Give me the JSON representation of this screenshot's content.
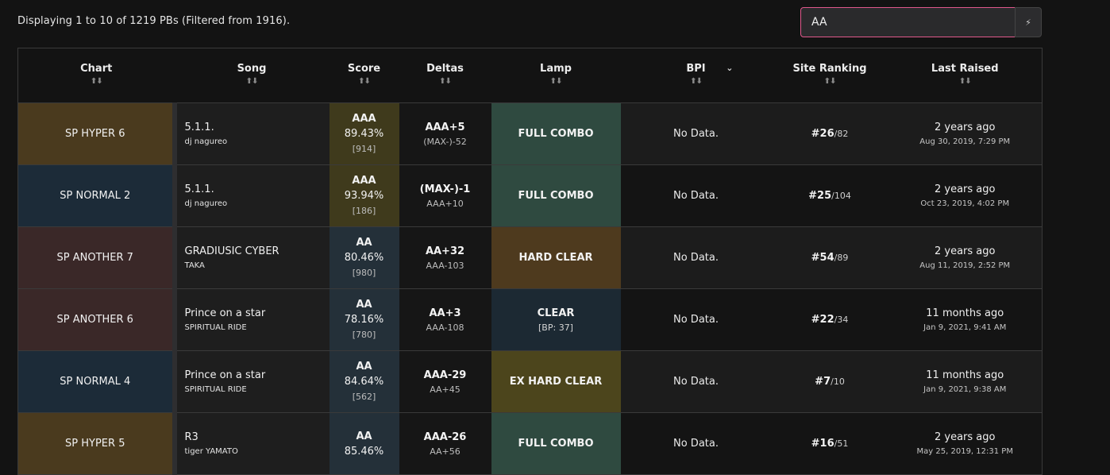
{
  "summary": "Displaying 1 to 10 of 1219 PBs (Filtered from 1916).",
  "search": {
    "value": "AA",
    "button_icon": "lightning-icon",
    "button_glyph": "⚡"
  },
  "columns": {
    "chart": "Chart",
    "song": "Song",
    "score": "Score",
    "deltas": "Deltas",
    "lamp": "Lamp",
    "bpi": "BPI",
    "ranking": "Site Ranking",
    "raised": "Last Raised",
    "sort_glyph": "⬆⬇",
    "bpi_chevron": "⌄"
  },
  "rows": [
    {
      "chart": "SP HYPER 6",
      "chart_class": "c-hyper",
      "song_title": "5.1.1.",
      "song_artist": "dj nagureo",
      "grade": "AAA",
      "percent": "89.43%",
      "ex": "[914]",
      "score_class": "s-aaa",
      "delta_main": "AAA+5",
      "delta_sub": "(MAX-)-52",
      "lamp": "FULL COMBO",
      "lamp_sub": "",
      "lamp_class": "l-fc",
      "bpi": "No Data.",
      "rank": "#26",
      "rank_total": "/82",
      "raised_rel": "2 years ago",
      "raised_abs": "Aug 30, 2019, 7:29 PM"
    },
    {
      "chart": "SP NORMAL 2",
      "chart_class": "c-normal",
      "song_title": "5.1.1.",
      "song_artist": "dj nagureo",
      "grade": "AAA",
      "percent": "93.94%",
      "ex": "[186]",
      "score_class": "s-aaa",
      "delta_main": "(MAX-)-1",
      "delta_sub": "AAA+10",
      "lamp": "FULL COMBO",
      "lamp_sub": "",
      "lamp_class": "l-fc",
      "bpi": "No Data.",
      "rank": "#25",
      "rank_total": "/104",
      "raised_rel": "2 years ago",
      "raised_abs": "Oct 23, 2019, 4:02 PM"
    },
    {
      "chart": "SP ANOTHER 7",
      "chart_class": "c-another",
      "song_title": "GRADIUSIC CYBER",
      "song_artist": "TAKA",
      "grade": "AA",
      "percent": "80.46%",
      "ex": "[980]",
      "score_class": "s-aa",
      "delta_main": "AA+32",
      "delta_sub": "AAA-103",
      "lamp": "HARD CLEAR",
      "lamp_sub": "",
      "lamp_class": "l-hard",
      "bpi": "No Data.",
      "rank": "#54",
      "rank_total": "/89",
      "raised_rel": "2 years ago",
      "raised_abs": "Aug 11, 2019, 2:52 PM"
    },
    {
      "chart": "SP ANOTHER 6",
      "chart_class": "c-another",
      "song_title": "Prince on a star",
      "song_artist": "SPIRITUAL RIDE",
      "grade": "AA",
      "percent": "78.16%",
      "ex": "[780]",
      "score_class": "s-aa",
      "delta_main": "AA+3",
      "delta_sub": "AAA-108",
      "lamp": "CLEAR",
      "lamp_sub": "[BP: 37]",
      "lamp_class": "l-clear",
      "bpi": "No Data.",
      "rank": "#22",
      "rank_total": "/34",
      "raised_rel": "11 months ago",
      "raised_abs": "Jan 9, 2021, 9:41 AM"
    },
    {
      "chart": "SP NORMAL 4",
      "chart_class": "c-normal",
      "song_title": "Prince on a star",
      "song_artist": "SPIRITUAL RIDE",
      "grade": "AA",
      "percent": "84.64%",
      "ex": "[562]",
      "score_class": "s-aa",
      "delta_main": "AAA-29",
      "delta_sub": "AA+45",
      "lamp": "EX HARD CLEAR",
      "lamp_sub": "",
      "lamp_class": "l-ex",
      "bpi": "No Data.",
      "rank": "#7",
      "rank_total": "/10",
      "raised_rel": "11 months ago",
      "raised_abs": "Jan 9, 2021, 9:38 AM"
    },
    {
      "chart": "SP HYPER 5",
      "chart_class": "c-hyper",
      "song_title": "R3",
      "song_artist": "tiger YAMATO",
      "grade": "AA",
      "percent": "85.46%",
      "ex": "",
      "score_class": "s-aa",
      "delta_main": "AAA-26",
      "delta_sub": "AA+56",
      "lamp": "FULL COMBO",
      "lamp_sub": "",
      "lamp_class": "l-fc",
      "bpi": "No Data.",
      "rank": "#16",
      "rank_total": "/51",
      "raised_rel": "2 years ago",
      "raised_abs": "May 25, 2019, 12:31 PM"
    }
  ]
}
